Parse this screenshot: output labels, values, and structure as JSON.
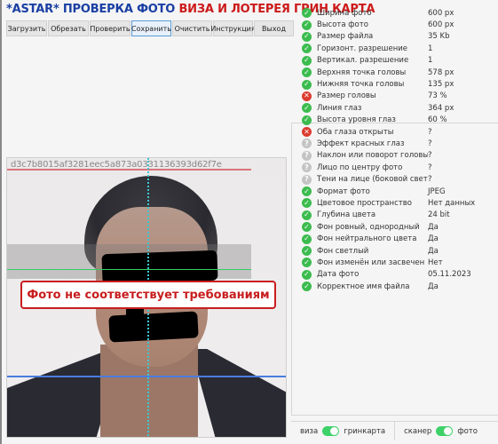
{
  "header": {
    "title_part1": "*ASTAR* ПРОВЕРКА ФОТО",
    "title_part2": "ВИЗА И ЛОТЕРЕЯ ГРИН КАРТА",
    "colors": {
      "part1": "#1a3fa3",
      "part2": "#cc1a1a"
    }
  },
  "toolbar": {
    "buttons": [
      {
        "label": "Загрузить"
      },
      {
        "label": "Обрезать"
      },
      {
        "label": "Проверить"
      },
      {
        "label": "Сохранить",
        "active": true
      },
      {
        "label": "Очистить"
      },
      {
        "label": "Инструкция"
      },
      {
        "label": "Выход"
      }
    ]
  },
  "photo": {
    "hash": "d3c7b8015af3281eec5a873a0331136393d62f7e",
    "warning": "Фото не соответствует требованиям",
    "warning_color": "#c81e1e"
  },
  "checks": [
    {
      "status": "ok",
      "label": "Ширина фото",
      "value": "600 px"
    },
    {
      "status": "ok",
      "label": "Высота фото",
      "value": "600 px"
    },
    {
      "status": "ok",
      "label": "Размер файла",
      "value": "35 Kb"
    },
    {
      "status": "ok",
      "label": "Горизонт. разрешение",
      "value": "1"
    },
    {
      "status": "ok",
      "label": "Вертикал. разрешение",
      "value": "1"
    },
    {
      "status": "ok",
      "label": "Верхняя точка головы",
      "value": "578 px"
    },
    {
      "status": "ok",
      "label": "Нижняя точка головы",
      "value": "135 px"
    },
    {
      "status": "error",
      "label": "Размер головы",
      "value": "73 %"
    },
    {
      "status": "ok",
      "label": "Линия глаз",
      "value": "364 px"
    },
    {
      "status": "ok",
      "label": "Высота уровня глаз",
      "value": "60 %"
    },
    {
      "status": "error",
      "label": "Оба глаза открыты",
      "value": "?"
    },
    {
      "status": "unknown",
      "label": "Эффект красных глаз",
      "value": "?"
    },
    {
      "status": "unknown",
      "label": "Наклон или поворот головы",
      "value": "?"
    },
    {
      "status": "unknown",
      "label": "Лицо по центру фото",
      "value": "?"
    },
    {
      "status": "unknown",
      "label": "Тени на лице (боковой свет)",
      "value": "?"
    },
    {
      "status": "ok",
      "label": "Формат фото",
      "value": "JPEG"
    },
    {
      "status": "ok",
      "label": "Цветовое пространство",
      "value": "Нет данных"
    },
    {
      "status": "ok",
      "label": "Глубина цвета",
      "value": "24 bit"
    },
    {
      "status": "ok",
      "label": "Фон ровный, однородный",
      "value": "Да"
    },
    {
      "status": "ok",
      "label": "Фон нейтрального цвета",
      "value": "Да"
    },
    {
      "status": "ok",
      "label": "Фон светлый",
      "value": "Да"
    },
    {
      "status": "ok",
      "label": "Фон изменён или засвечен",
      "value": "Нет"
    },
    {
      "status": "ok",
      "label": "Дата фото",
      "value": "05.11.2023"
    },
    {
      "status": "ok",
      "label": "Корректное имя файла",
      "value": "Да"
    }
  ],
  "status_colors": {
    "ok": "#3cbc4f",
    "error": "#dc3b2f",
    "unknown": "#c4c4c4"
  },
  "footer": {
    "toggle1": {
      "left": "виза",
      "right": "гринкарта",
      "on": true
    },
    "toggle2": {
      "left": "сканер",
      "right": "фото",
      "on": true
    },
    "toggle_color": "#3ed16a"
  }
}
